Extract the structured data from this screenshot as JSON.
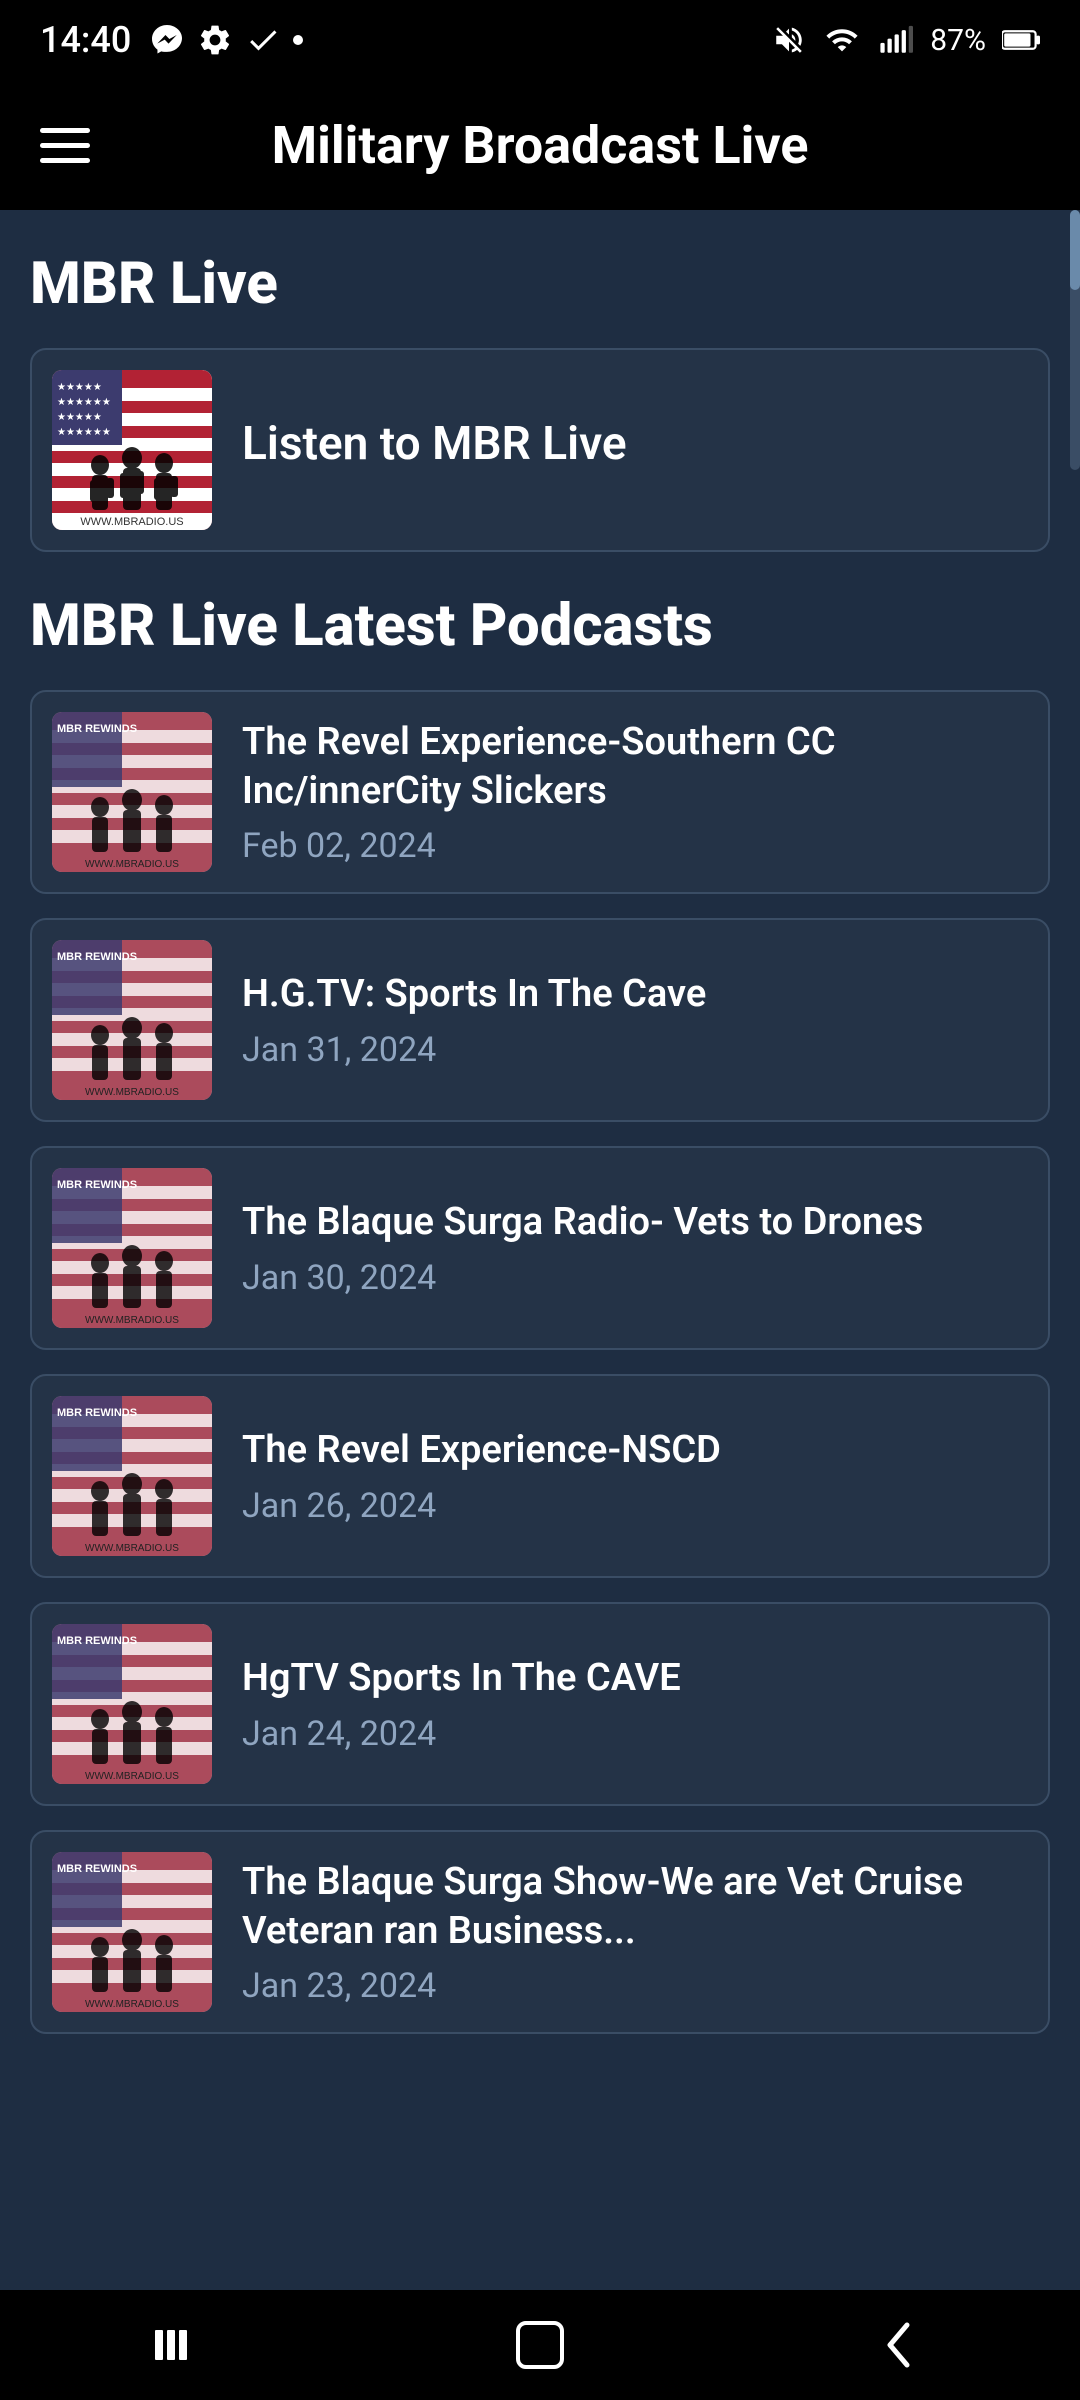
{
  "statusBar": {
    "time": "14:40",
    "battery": "87%",
    "icons": [
      "messenger",
      "settings",
      "check",
      "dot"
    ]
  },
  "appBar": {
    "title": "Military Broadcast Live",
    "menuLabel": "menu"
  },
  "liveSection": {
    "heading": "MBR Live",
    "liveCard": {
      "title": "Listen to MBR Live"
    }
  },
  "podcastsSection": {
    "heading": "MBR Live Latest Podcasts",
    "podcasts": [
      {
        "title": "The Revel Experience-Southern CC Inc/innerCity Slickers",
        "date": "Feb 02, 2024"
      },
      {
        "title": "H.G.TV: Sports In The Cave",
        "date": "Jan 31, 2024"
      },
      {
        "title": "The Blaque Surga Radio- Vets to Drones",
        "date": "Jan 30, 2024"
      },
      {
        "title": "The Revel Experience-NSCD",
        "date": "Jan 26, 2024"
      },
      {
        "title": "HgTV Sports In The CAVE",
        "date": "Jan 24, 2024"
      },
      {
        "title": "The Blaque Surga Show-We are Vet Cruise Veteran ran Business...",
        "date": "Jan 23, 2024"
      }
    ]
  },
  "bottomNav": {
    "items": [
      {
        "icon": "|||",
        "name": "recent-apps"
      },
      {
        "icon": "□",
        "name": "home"
      },
      {
        "icon": "‹",
        "name": "back"
      }
    ]
  },
  "colors": {
    "background": "#1e2d42",
    "cardBg": "#243347",
    "cardBorder": "#3a4d65",
    "titleColor": "#ffffff",
    "dateColor": "#8fa5c0",
    "appBarBg": "#000000"
  }
}
